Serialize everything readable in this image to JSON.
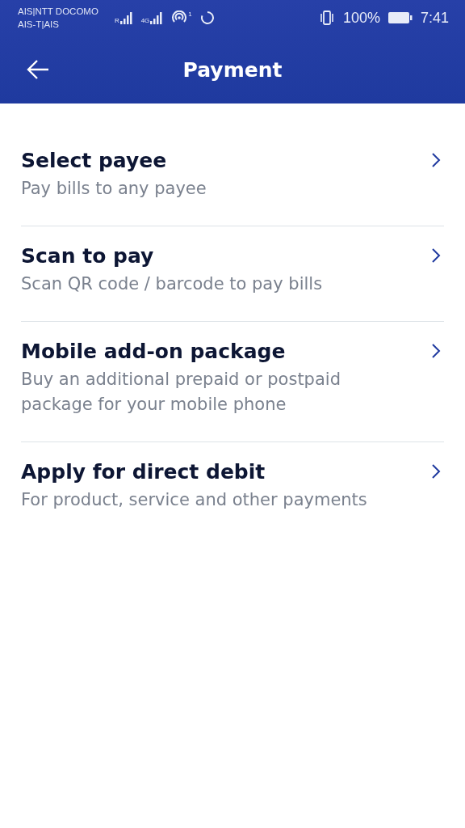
{
  "status_bar": {
    "carrier_1": "AIS|NTT DOCOMO",
    "carrier_2": "AIS-T|AIS",
    "roaming": "R",
    "network": "4G",
    "hotspot_count": "1",
    "battery": "100%",
    "time": "7:41"
  },
  "header": {
    "title": "Payment"
  },
  "items": [
    {
      "title": "Select payee",
      "subtitle": "Pay bills to any payee"
    },
    {
      "title": "Scan to pay",
      "subtitle": "Scan QR code / barcode to pay bills"
    },
    {
      "title": "Mobile add-on package",
      "subtitle": "Buy an additional prepaid or postpaid package for your mobile phone"
    },
    {
      "title": "Apply for direct debit",
      "subtitle": "For product, service and other payments"
    }
  ]
}
